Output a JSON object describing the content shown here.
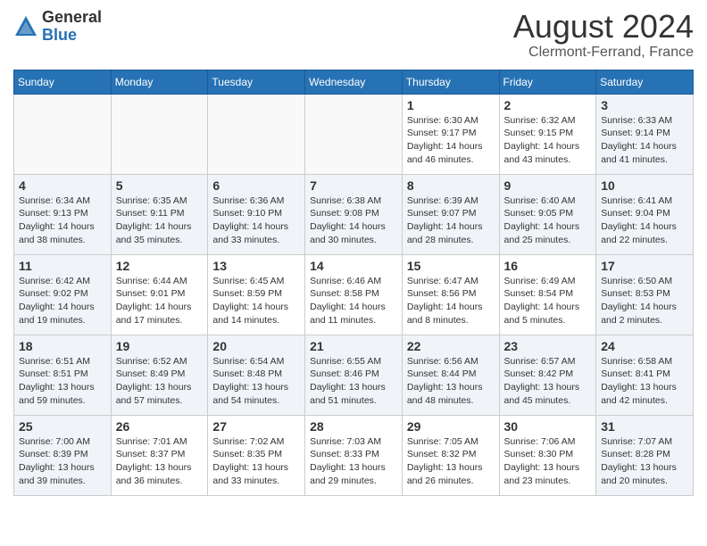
{
  "header": {
    "logo_general": "General",
    "logo_blue": "Blue",
    "month_year": "August 2024",
    "city": "Clermont-Ferrand, France"
  },
  "days_of_week": [
    "Sunday",
    "Monday",
    "Tuesday",
    "Wednesday",
    "Thursday",
    "Friday",
    "Saturday"
  ],
  "weeks": [
    {
      "days": [
        {
          "number": "",
          "info": "",
          "empty": true
        },
        {
          "number": "",
          "info": "",
          "empty": true
        },
        {
          "number": "",
          "info": "",
          "empty": true
        },
        {
          "number": "",
          "info": "",
          "empty": true
        },
        {
          "number": "1",
          "info": "Sunrise: 6:30 AM\nSunset: 9:17 PM\nDaylight: 14 hours\nand 46 minutes.",
          "empty": false
        },
        {
          "number": "2",
          "info": "Sunrise: 6:32 AM\nSunset: 9:15 PM\nDaylight: 14 hours\nand 43 minutes.",
          "empty": false
        },
        {
          "number": "3",
          "info": "Sunrise: 6:33 AM\nSunset: 9:14 PM\nDaylight: 14 hours\nand 41 minutes.",
          "empty": false
        }
      ]
    },
    {
      "days": [
        {
          "number": "4",
          "info": "Sunrise: 6:34 AM\nSunset: 9:13 PM\nDaylight: 14 hours\nand 38 minutes.",
          "empty": false
        },
        {
          "number": "5",
          "info": "Sunrise: 6:35 AM\nSunset: 9:11 PM\nDaylight: 14 hours\nand 35 minutes.",
          "empty": false
        },
        {
          "number": "6",
          "info": "Sunrise: 6:36 AM\nSunset: 9:10 PM\nDaylight: 14 hours\nand 33 minutes.",
          "empty": false
        },
        {
          "number": "7",
          "info": "Sunrise: 6:38 AM\nSunset: 9:08 PM\nDaylight: 14 hours\nand 30 minutes.",
          "empty": false
        },
        {
          "number": "8",
          "info": "Sunrise: 6:39 AM\nSunset: 9:07 PM\nDaylight: 14 hours\nand 28 minutes.",
          "empty": false
        },
        {
          "number": "9",
          "info": "Sunrise: 6:40 AM\nSunset: 9:05 PM\nDaylight: 14 hours\nand 25 minutes.",
          "empty": false
        },
        {
          "number": "10",
          "info": "Sunrise: 6:41 AM\nSunset: 9:04 PM\nDaylight: 14 hours\nand 22 minutes.",
          "empty": false
        }
      ]
    },
    {
      "days": [
        {
          "number": "11",
          "info": "Sunrise: 6:42 AM\nSunset: 9:02 PM\nDaylight: 14 hours\nand 19 minutes.",
          "empty": false
        },
        {
          "number": "12",
          "info": "Sunrise: 6:44 AM\nSunset: 9:01 PM\nDaylight: 14 hours\nand 17 minutes.",
          "empty": false
        },
        {
          "number": "13",
          "info": "Sunrise: 6:45 AM\nSunset: 8:59 PM\nDaylight: 14 hours\nand 14 minutes.",
          "empty": false
        },
        {
          "number": "14",
          "info": "Sunrise: 6:46 AM\nSunset: 8:58 PM\nDaylight: 14 hours\nand 11 minutes.",
          "empty": false
        },
        {
          "number": "15",
          "info": "Sunrise: 6:47 AM\nSunset: 8:56 PM\nDaylight: 14 hours\nand 8 minutes.",
          "empty": false
        },
        {
          "number": "16",
          "info": "Sunrise: 6:49 AM\nSunset: 8:54 PM\nDaylight: 14 hours\nand 5 minutes.",
          "empty": false
        },
        {
          "number": "17",
          "info": "Sunrise: 6:50 AM\nSunset: 8:53 PM\nDaylight: 14 hours\nand 2 minutes.",
          "empty": false
        }
      ]
    },
    {
      "days": [
        {
          "number": "18",
          "info": "Sunrise: 6:51 AM\nSunset: 8:51 PM\nDaylight: 13 hours\nand 59 minutes.",
          "empty": false
        },
        {
          "number": "19",
          "info": "Sunrise: 6:52 AM\nSunset: 8:49 PM\nDaylight: 13 hours\nand 57 minutes.",
          "empty": false
        },
        {
          "number": "20",
          "info": "Sunrise: 6:54 AM\nSunset: 8:48 PM\nDaylight: 13 hours\nand 54 minutes.",
          "empty": false
        },
        {
          "number": "21",
          "info": "Sunrise: 6:55 AM\nSunset: 8:46 PM\nDaylight: 13 hours\nand 51 minutes.",
          "empty": false
        },
        {
          "number": "22",
          "info": "Sunrise: 6:56 AM\nSunset: 8:44 PM\nDaylight: 13 hours\nand 48 minutes.",
          "empty": false
        },
        {
          "number": "23",
          "info": "Sunrise: 6:57 AM\nSunset: 8:42 PM\nDaylight: 13 hours\nand 45 minutes.",
          "empty": false
        },
        {
          "number": "24",
          "info": "Sunrise: 6:58 AM\nSunset: 8:41 PM\nDaylight: 13 hours\nand 42 minutes.",
          "empty": false
        }
      ]
    },
    {
      "days": [
        {
          "number": "25",
          "info": "Sunrise: 7:00 AM\nSunset: 8:39 PM\nDaylight: 13 hours\nand 39 minutes.",
          "empty": false
        },
        {
          "number": "26",
          "info": "Sunrise: 7:01 AM\nSunset: 8:37 PM\nDaylight: 13 hours\nand 36 minutes.",
          "empty": false
        },
        {
          "number": "27",
          "info": "Sunrise: 7:02 AM\nSunset: 8:35 PM\nDaylight: 13 hours\nand 33 minutes.",
          "empty": false
        },
        {
          "number": "28",
          "info": "Sunrise: 7:03 AM\nSunset: 8:33 PM\nDaylight: 13 hours\nand 29 minutes.",
          "empty": false
        },
        {
          "number": "29",
          "info": "Sunrise: 7:05 AM\nSunset: 8:32 PM\nDaylight: 13 hours\nand 26 minutes.",
          "empty": false
        },
        {
          "number": "30",
          "info": "Sunrise: 7:06 AM\nSunset: 8:30 PM\nDaylight: 13 hours\nand 23 minutes.",
          "empty": false
        },
        {
          "number": "31",
          "info": "Sunrise: 7:07 AM\nSunset: 8:28 PM\nDaylight: 13 hours\nand 20 minutes.",
          "empty": false
        }
      ]
    }
  ]
}
